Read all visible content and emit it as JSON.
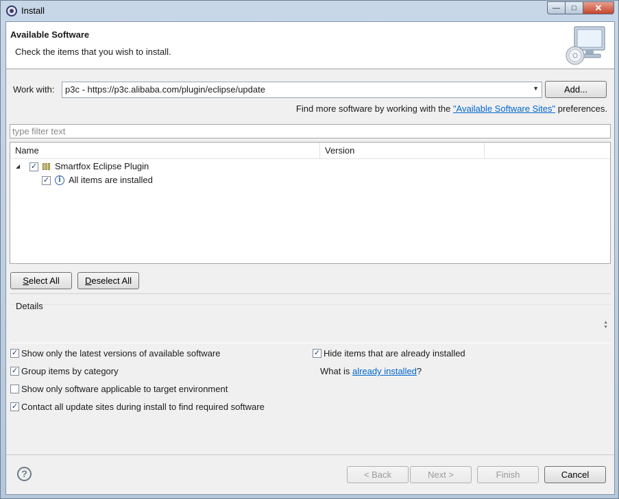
{
  "window": {
    "title": "Install"
  },
  "header": {
    "title": "Available Software",
    "description": "Check the items that you wish to install."
  },
  "work_with": {
    "label": "Work with:",
    "value": "p3c - https://p3c.alibaba.com/plugin/eclipse/update",
    "add_label": "Add...",
    "find_more_prefix": "Find more software by working with the ",
    "find_more_link": "\"Available Software Sites\"",
    "find_more_suffix": " preferences."
  },
  "filter": {
    "placeholder": "type filter text"
  },
  "tree": {
    "columns": [
      "Name",
      "Version"
    ],
    "items": [
      {
        "label": "Smartfox Eclipse Plugin",
        "checked": true,
        "expanded": true
      },
      {
        "label": "All items are installed",
        "checked": true,
        "icon": "info-icon"
      }
    ]
  },
  "selection_buttons": {
    "select_all": "Select All",
    "deselect_all": "Deselect All"
  },
  "details": {
    "label": "Details"
  },
  "options": {
    "latest_versions": "Show only the latest versions of available software",
    "group_by_category": "Group items by category",
    "target_env": "Show only software applicable to target environment",
    "contact_sites": "Contact all update sites during install to find required software",
    "hide_installed": "Hide items that are already installed",
    "what_is_prefix": "What is ",
    "what_is_link": "already installed",
    "what_is_suffix": "?"
  },
  "footer": {
    "back": "< Back",
    "next": "Next >",
    "finish": "Finish",
    "cancel": "Cancel"
  },
  "colors": {
    "accent_link": "#0066cc",
    "close_button": "#c6452c"
  }
}
